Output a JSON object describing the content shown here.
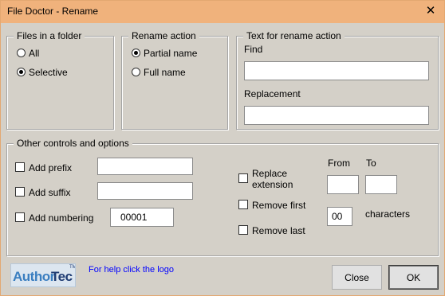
{
  "window": {
    "title": "File Doctor - Rename",
    "close_glyph": "✕"
  },
  "files_in_folder": {
    "title": "Files in a folder",
    "options": [
      {
        "label": "All",
        "selected": false
      },
      {
        "label": "Selective",
        "selected": true
      }
    ]
  },
  "rename_action": {
    "title": "Rename action",
    "options": [
      {
        "label": "Partial name",
        "selected": true
      },
      {
        "label": "Full name",
        "selected": false
      }
    ]
  },
  "rename_text": {
    "title": "Text for rename action",
    "find_label": "Find",
    "find_value": "",
    "replacement_label": "Replacement",
    "replacement_value": ""
  },
  "other_controls": {
    "title": "Other controls and options",
    "add_prefix": {
      "label": "Add prefix",
      "checked": false,
      "value": ""
    },
    "add_suffix": {
      "label": "Add suffix",
      "checked": false,
      "value": ""
    },
    "add_numbering": {
      "label": "Add numbering",
      "checked": false,
      "value": "00001"
    },
    "replace_extension": {
      "label_line1": "Replace",
      "label_line2": "extension",
      "checked": false
    },
    "remove_first": {
      "label": "Remove first",
      "checked": false
    },
    "remove_last": {
      "label": "Remove last",
      "checked": false
    },
    "from_label": "From",
    "from_value": "",
    "to_label": "To",
    "to_value": "",
    "count_value": "00",
    "characters_label": "characters"
  },
  "footer": {
    "logo_part1": "Author",
    "logo_part2": "Tec",
    "logo_tm": "TM",
    "help_text": "For help click the logo",
    "close_label": "Close",
    "ok_label": "OK"
  },
  "colors": {
    "titlebar": "#f0b27c",
    "dialog_bg": "#d4d0c8",
    "help_link": "#0000ff",
    "logo_blue": "#3a7ec0",
    "logo_navy": "#1f3c73"
  }
}
